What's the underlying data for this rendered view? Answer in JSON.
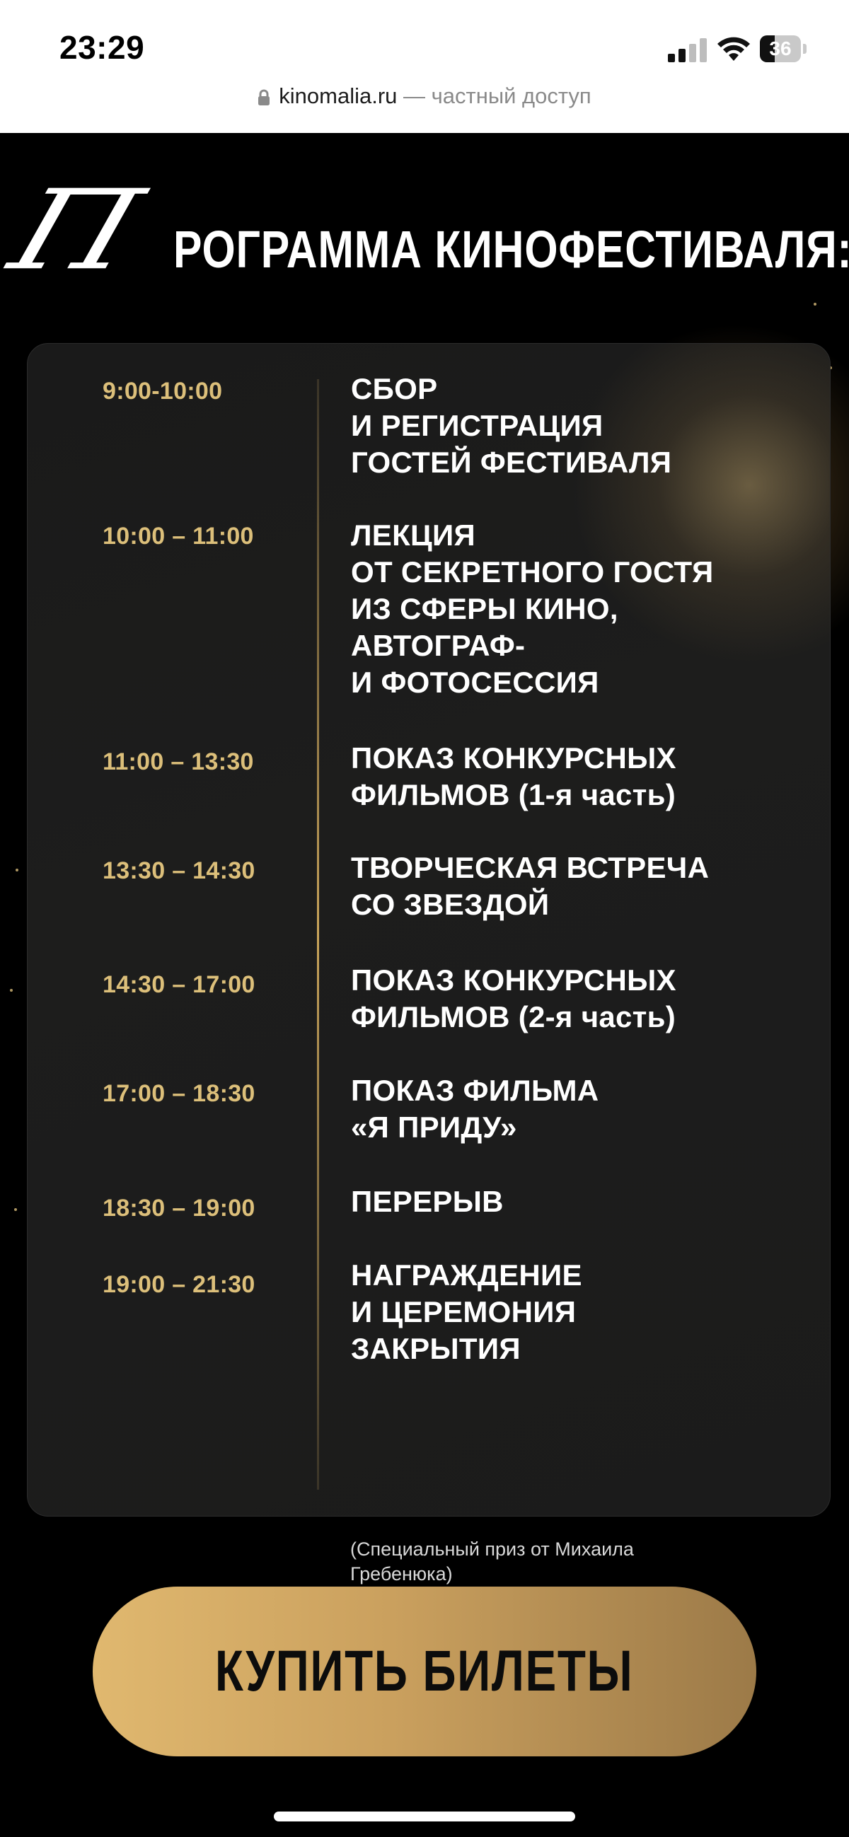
{
  "status_bar": {
    "time": "23:29",
    "battery": "36",
    "battery_level_percent": 36
  },
  "url_bar": {
    "domain": "kinomalia.ru",
    "separator": " — ",
    "access_text": "частный доступ"
  },
  "heading": {
    "script_letter": "П",
    "title_rest": "РОГРАММА КИНОФЕСТИВАЛЯ:"
  },
  "schedule": [
    {
      "time": "9:00-10:00",
      "lines": [
        "СБОР",
        "И РЕГИСТРАЦИЯ",
        "ГОСТЕЙ ФЕСТИВАЛЯ"
      ]
    },
    {
      "time": "10:00 – 11:00",
      "lines": [
        "ЛЕКЦИЯ",
        "ОТ СЕКРЕТНОГО ГОСТЯ",
        "ИЗ СФЕРЫ КИНО,",
        "АВТОГРАФ-",
        "И ФОТОСЕССИЯ"
      ]
    },
    {
      "time": "11:00 – 13:30",
      "lines": [
        "ПОКАЗ КОНКУРСНЫХ",
        "ФИЛЬМОВ (1-я часть)"
      ]
    },
    {
      "time": "13:30 – 14:30",
      "lines": [
        "ТВОРЧЕСКАЯ ВСТРЕЧА",
        "СО ЗВЕЗДОЙ"
      ]
    },
    {
      "time": "14:30 – 17:00",
      "lines": [
        "ПОКАЗ КОНКУРСНЫХ",
        "ФИЛЬМОВ (2-я часть)"
      ]
    },
    {
      "time": "17:00 – 18:30",
      "lines": [
        "ПОКАЗ ФИЛЬМА",
        "«Я ПРИДУ»"
      ]
    },
    {
      "time": "18:30 – 19:00",
      "lines": [
        "ПЕРЕРЫВ"
      ]
    },
    {
      "time": "19:00 – 21:30",
      "lines": [
        "НАГРАЖДЕНИЕ",
        "И ЦЕРЕМОНИЯ",
        "ЗАКРЫТИЯ"
      ]
    }
  ],
  "note": {
    "line1": "(Специальный приз от Михаила",
    "line2": "Гребенюка)"
  },
  "cta": {
    "label": "КУПИТЬ БИЛЕТЫ"
  },
  "colors": {
    "gold": "#dcbf7a",
    "button_gold": "#caa05e",
    "background": "#000000",
    "card": "#1b1b1b"
  }
}
